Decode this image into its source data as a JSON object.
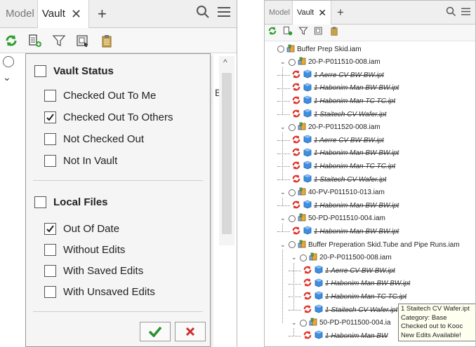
{
  "left": {
    "tabs": {
      "model": "Model",
      "vault": "Vault"
    },
    "side_text": "BV",
    "filter": {
      "vault_status": {
        "heading": "Vault Status",
        "checked": false,
        "items": [
          {
            "label": "Checked Out To Me",
            "checked": false
          },
          {
            "label": "Checked Out To Others",
            "checked": true
          },
          {
            "label": "Not Checked Out",
            "checked": false
          },
          {
            "label": "Not In Vault",
            "checked": false
          }
        ]
      },
      "local_files": {
        "heading": "Local Files",
        "checked": false,
        "items": [
          {
            "label": "Out Of Date",
            "checked": true
          },
          {
            "label": "Without Edits",
            "checked": false
          },
          {
            "label": "With Saved Edits",
            "checked": false
          },
          {
            "label": "With Unsaved Edits",
            "checked": false
          }
        ]
      }
    }
  },
  "right": {
    "tabs": {
      "model": "Model",
      "vault": "Vault"
    },
    "tree": [
      {
        "label": "Buffer Prep Skid.iam",
        "kind": "asm",
        "depth": 0,
        "chev": false
      },
      {
        "label": "20-P-P011510-008.iam",
        "kind": "asm",
        "depth": 1,
        "chev": true
      },
      {
        "label": "1 Aerre CV BW BW.ipt",
        "kind": "part",
        "depth": 2
      },
      {
        "label": "1 Habonim Man BW BW.ipt",
        "kind": "part",
        "depth": 2
      },
      {
        "label": "1 Habonim Man TC TC.ipt",
        "kind": "part",
        "depth": 2
      },
      {
        "label": "1 Staitech CV Wafer.ipt",
        "kind": "part",
        "depth": 2
      },
      {
        "label": "20-P-P011520-008.iam",
        "kind": "asm",
        "depth": 1,
        "chev": true
      },
      {
        "label": "1 Aerre CV BW BW.ipt",
        "kind": "part",
        "depth": 2
      },
      {
        "label": "1 Habonim Man BW BW.ipt",
        "kind": "part",
        "depth": 2
      },
      {
        "label": "1 Habonim Man TC TC.ipt",
        "kind": "part",
        "depth": 2
      },
      {
        "label": "1 Staitech CV Wafer.ipt",
        "kind": "part",
        "depth": 2
      },
      {
        "label": "40-PV-P011510-013.iam",
        "kind": "asm",
        "depth": 1,
        "chev": true
      },
      {
        "label": "1 Habonim Man BW BW.ipt",
        "kind": "part",
        "depth": 2
      },
      {
        "label": "50-PD-P011510-004.iam",
        "kind": "asm",
        "depth": 1,
        "chev": true
      },
      {
        "label": "1 Habonim Man BW BW.ipt",
        "kind": "part",
        "depth": 2
      },
      {
        "label": "Buffer Preperation Skid.Tube and Pipe Runs.iam",
        "kind": "asm",
        "depth": 1,
        "chev": true
      },
      {
        "label": "20-P-P011500-008.iam",
        "kind": "asm",
        "depth": 2,
        "chev": true
      },
      {
        "label": "1 Aerre CV BW BW.ipt",
        "kind": "part",
        "depth": 3
      },
      {
        "label": "1 Habonim Man BW BW.ipt",
        "kind": "part",
        "depth": 3
      },
      {
        "label": "1 Habonim Man TC TC.ipt",
        "kind": "part",
        "depth": 3
      },
      {
        "label": "1 Staitech CV Wafer.ipt",
        "kind": "part",
        "depth": 3
      },
      {
        "label": "50-PD-P011500-004.ia",
        "kind": "asm",
        "depth": 2,
        "chev": true
      },
      {
        "label": "1 Habonim Man BW",
        "kind": "part",
        "depth": 3
      }
    ],
    "tooltip": {
      "line1": "1 Staitech CV Wafer.ipt",
      "line2": "Category: Base",
      "line3": "Checked out to Kooc",
      "line4": "New Edits Available!"
    }
  },
  "colors": {
    "refresh_green": "#2e9e2e",
    "status_red": "#e0352b",
    "part_blue": "#3e8fe0",
    "ok_green": "#2c8f2c",
    "cancel_red": "#d12b2b"
  }
}
